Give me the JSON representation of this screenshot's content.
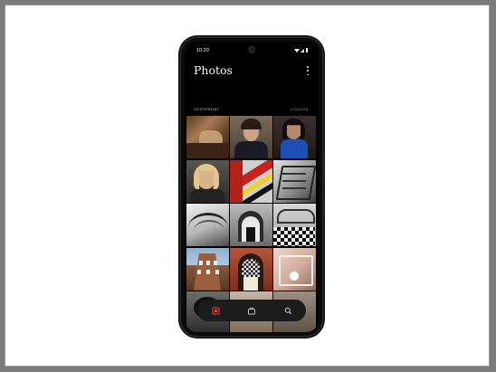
{
  "status_bar": {
    "time": "10:20"
  },
  "header": {
    "title": "Photos",
    "menu_icon": "more-vert-icon"
  },
  "section": {
    "label": "YESTERDAY",
    "location": "LONDON"
  },
  "photos": [
    "brown-interior-photo",
    "woman-portrait-photo",
    "woman-blue-scarf-photo",
    "blonde-portrait-photo",
    "red-yellow-stripes-photo",
    "bw-staircase-photo",
    "bw-curved-building-photo",
    "bw-archway-photo",
    "bw-checkered-lobby-photo",
    "brick-building-photo",
    "arched-doorway-photo",
    "pink-interior-photo",
    "dark-object-photo",
    "interior-photo",
    "partial-photo"
  ],
  "bottom_nav": [
    {
      "icon": "photos-icon",
      "active": true
    },
    {
      "icon": "albums-icon",
      "active": false
    },
    {
      "icon": "search-icon",
      "active": false
    }
  ],
  "colors": {
    "accent": "#e53935",
    "background": "#000000",
    "frame": "#7a7a7a"
  }
}
